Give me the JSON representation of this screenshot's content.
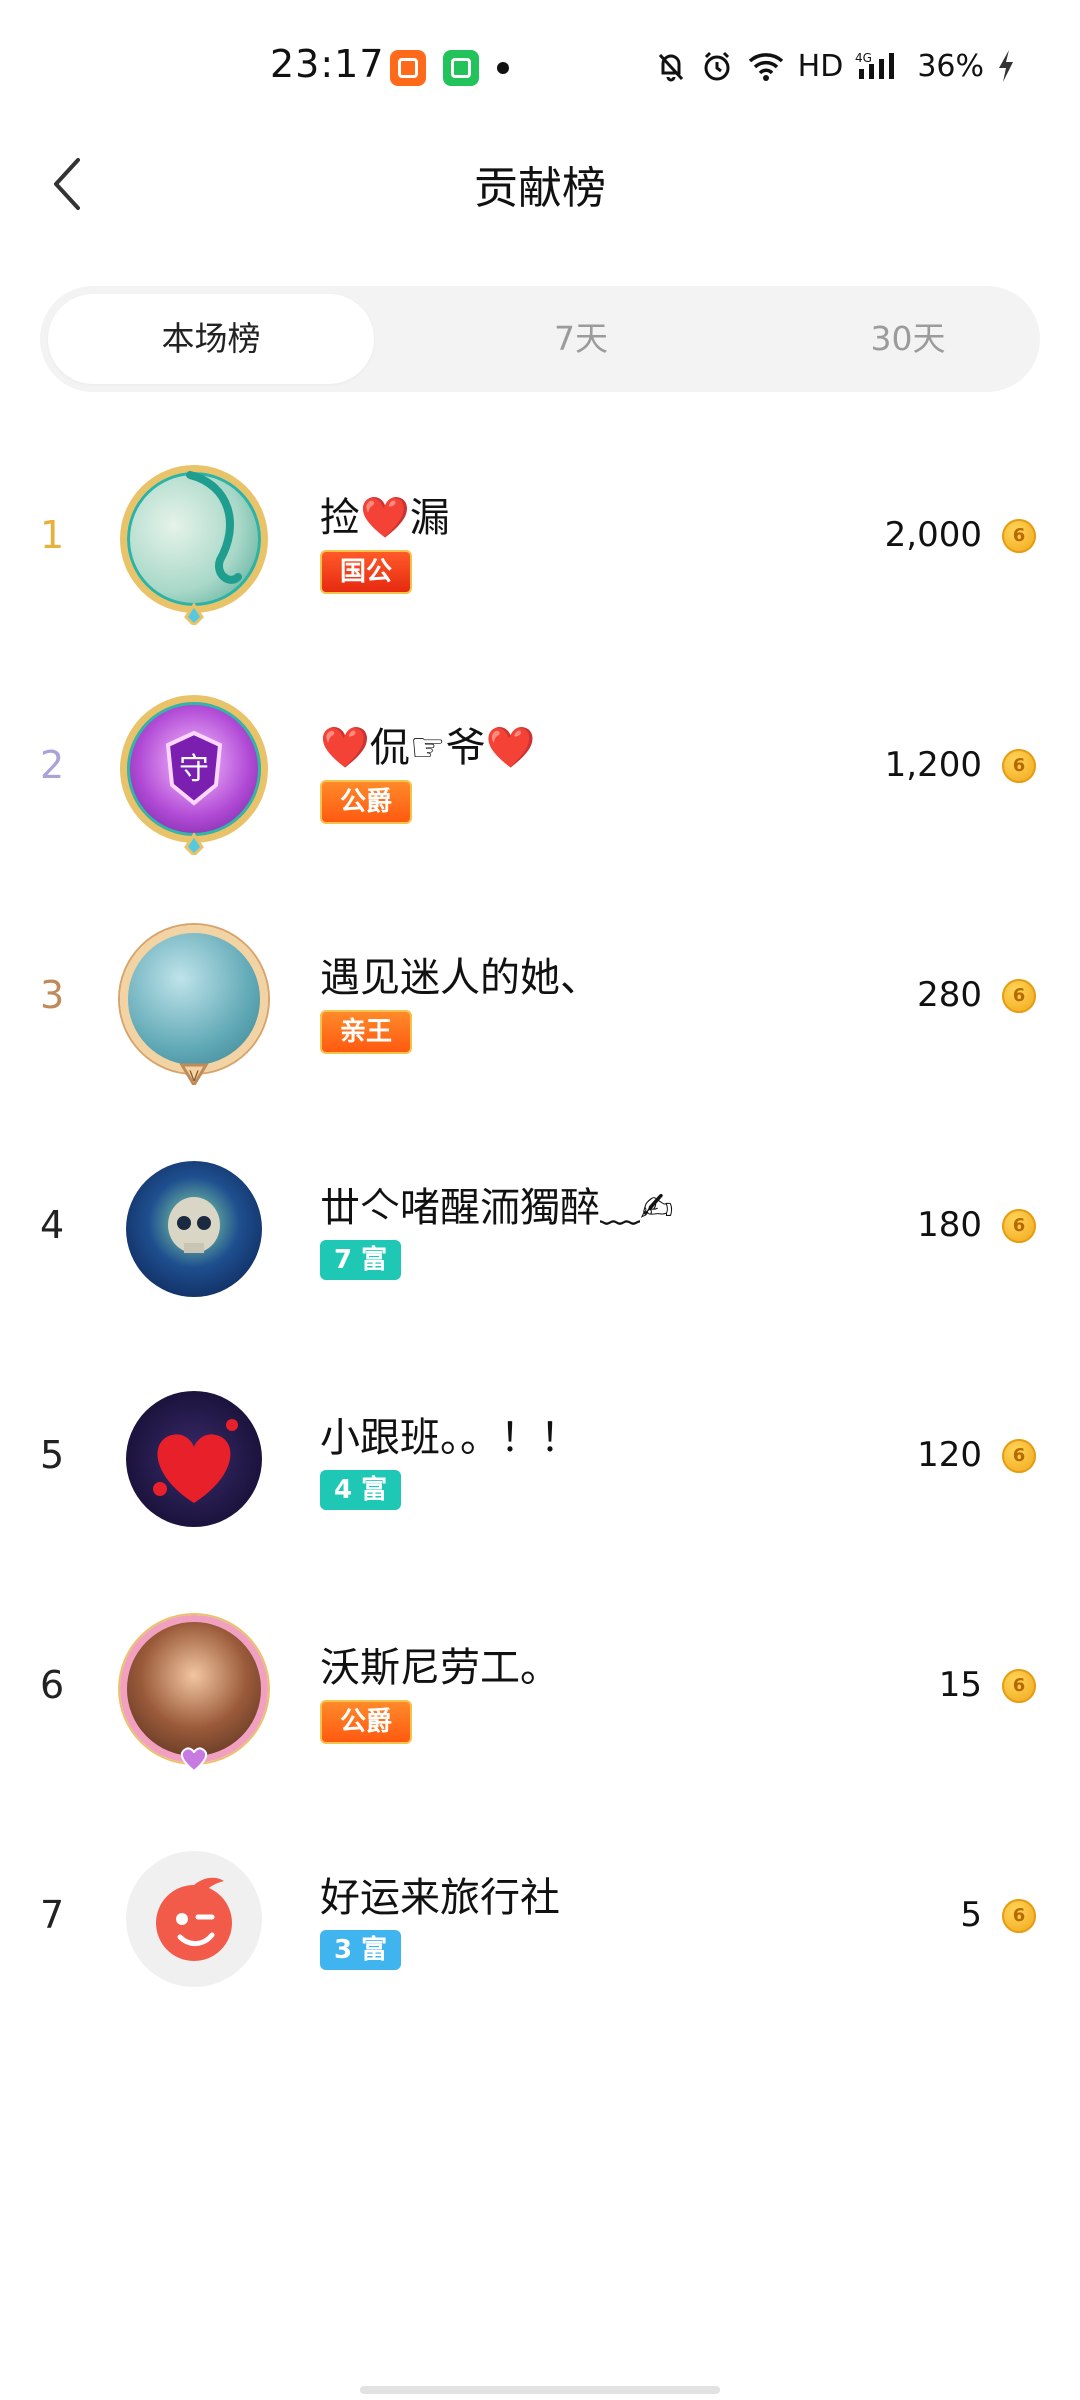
{
  "status_bar": {
    "time": "23:17",
    "network": "HD",
    "signal": "4G",
    "battery": "36%"
  },
  "header": {
    "title": "贡献榜"
  },
  "tabs": [
    {
      "label": "本场榜",
      "active": true
    },
    {
      "label": "7天",
      "active": false
    },
    {
      "label": "30天",
      "active": false
    }
  ],
  "coin_icon": "coin-icon",
  "entries": [
    {
      "rank": "1",
      "name": "捡❤️漏",
      "badge": "国公",
      "value": "2,000",
      "rank_color": "#e8b13a"
    },
    {
      "rank": "2",
      "name": "❤️侃☞爷❤️",
      "badge": "公爵",
      "value": "1,200",
      "rank_color": "#a9a3d8"
    },
    {
      "rank": "3",
      "name": "遇见迷人的她、",
      "badge": "亲王",
      "value": "280",
      "rank_color": "#c08a5a"
    },
    {
      "rank": "4",
      "name": "丗亽啫醒洏獨醉﹏✍",
      "badge": "7 富",
      "value": "180",
      "rank_color": "#222222"
    },
    {
      "rank": "5",
      "name": "小跟班。。！！",
      "badge": "4 富",
      "value": "120",
      "rank_color": "#222222"
    },
    {
      "rank": "6",
      "name": "沃斯尼劳工。",
      "badge": "公爵",
      "value": "15",
      "rank_color": "#222222"
    },
    {
      "rank": "7",
      "name": "好运来旅行社",
      "badge": "3 富",
      "value": "5",
      "rank_color": "#222222"
    }
  ]
}
